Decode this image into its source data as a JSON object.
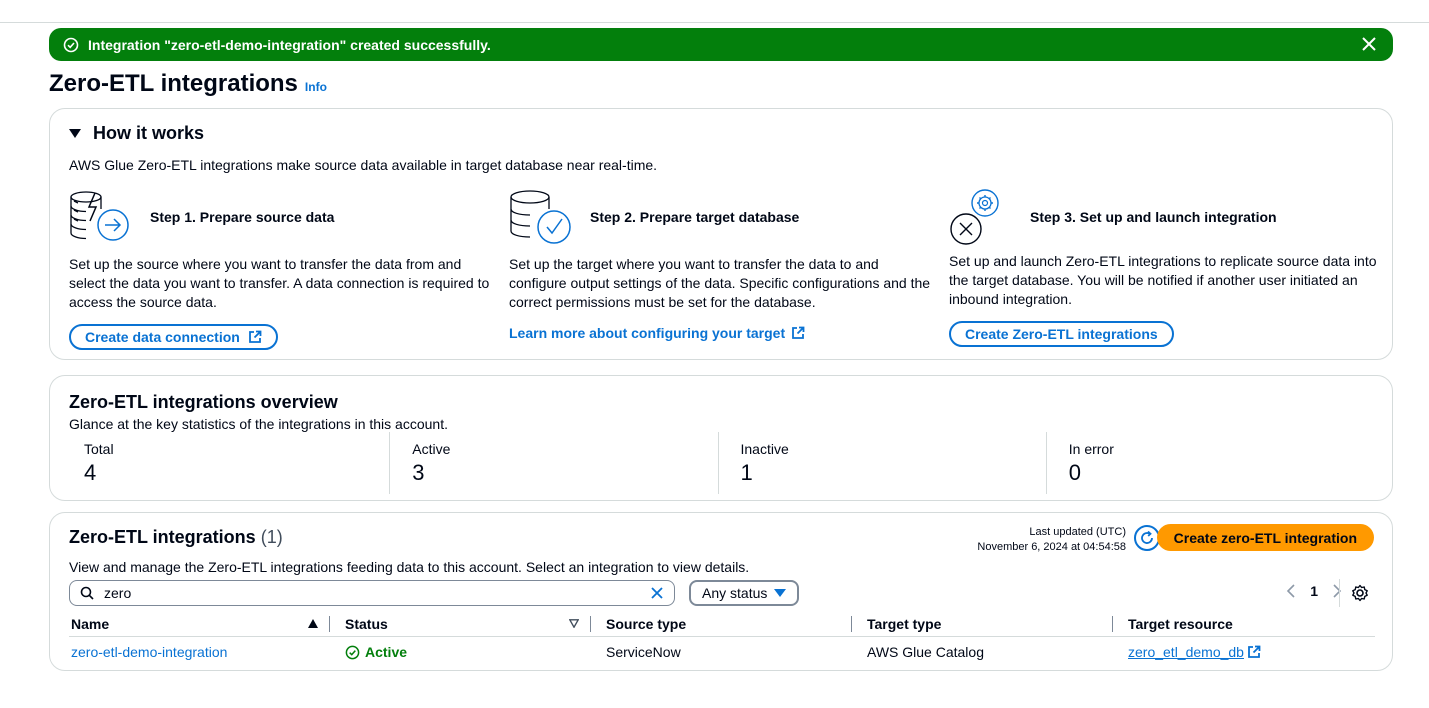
{
  "flash": {
    "message": "Integration \"zero-etl-demo-integration\" created successfully.",
    "color": "#037f0c"
  },
  "page": {
    "title": "Zero-ETL integrations",
    "info_label": "Info"
  },
  "how": {
    "title": "How it works",
    "description": "AWS Glue Zero-ETL integrations make source data available in target database near real-time.",
    "steps": [
      {
        "title": "Step 1. Prepare source data",
        "body": "Set up the source where you want to transfer the data from and select the data you want to transfer. A data connection is required to access the source data.",
        "action": "Create data connection",
        "icon": "database-arrow-icon"
      },
      {
        "title": "Step 2. Prepare target database",
        "body": "Set up the target where you want to transfer the data to and configure output settings of the data. Specific configurations and the correct permissions must be set for the database.",
        "action": "Learn more about configuring your target",
        "icon": "database-check-icon"
      },
      {
        "title": "Step 3. Set up and launch integration",
        "body": "Set up and launch Zero-ETL integrations to replicate source data into the target database. You will be notified if another user initiated an inbound integration.",
        "action": "Create Zero-ETL integrations",
        "icon": "integration-gear-icon"
      }
    ]
  },
  "overview": {
    "title": "Zero-ETL integrations overview",
    "description": "Glance at the key statistics of the integrations in this account.",
    "stats": [
      {
        "label": "Total",
        "value": "4"
      },
      {
        "label": "Active",
        "value": "3"
      },
      {
        "label": "Inactive",
        "value": "1"
      },
      {
        "label": "In error",
        "value": "0"
      }
    ]
  },
  "table": {
    "title": "Zero-ETL integrations",
    "count": "(1)",
    "description": "View and manage the Zero-ETL integrations feeding data to this account. Select an integration to view details.",
    "last_updated_label": "Last updated (UTC)",
    "last_updated_value": "November 6, 2024 at 04:54:58",
    "create_label": "Create zero-ETL integration",
    "search_value": "zero",
    "status_filter": "Any status",
    "page": "1",
    "columns": [
      "Name",
      "Status",
      "Source type",
      "Target type",
      "Target resource"
    ],
    "rows": [
      {
        "name": "zero-etl-demo-integration",
        "status": "Active",
        "source_type": "ServiceNow",
        "target_type": "AWS Glue Catalog",
        "target_resource": "zero_etl_demo_db"
      }
    ]
  },
  "colors": {
    "link": "#0972d3",
    "primary": "#ff9900",
    "success": "#037f0c"
  }
}
